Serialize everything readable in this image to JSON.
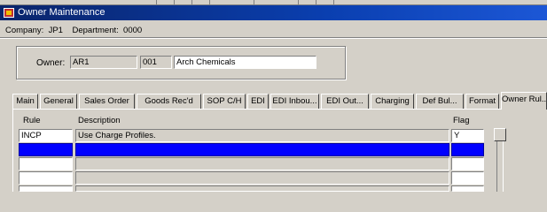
{
  "window": {
    "title": "Owner Maintenance"
  },
  "context": {
    "text": "Company:  JP1    Department:  0000"
  },
  "owner": {
    "label": "Owner:",
    "code": "AR1",
    "sub_code": "001",
    "name": "Arch Chemicals"
  },
  "tabs": [
    {
      "label": "Main"
    },
    {
      "label": "General"
    },
    {
      "label": "Sales Order"
    },
    {
      "label": "Goods Rec'd"
    },
    {
      "label": "SOP C/H"
    },
    {
      "label": "EDI"
    },
    {
      "label": "EDI Inbou..."
    },
    {
      "label": "EDI Out..."
    },
    {
      "label": "Charging"
    },
    {
      "label": "Def Bul..."
    },
    {
      "label": "Format"
    },
    {
      "label": "Owner Rul..."
    }
  ],
  "active_tab": "Owner Rul...",
  "grid": {
    "columns": {
      "rule": "Rule",
      "description": "Description",
      "flag": "Flag"
    },
    "rows": [
      {
        "rule": "INCP",
        "description": "Use Charge Profiles.",
        "flag": "Y"
      },
      {
        "rule": "",
        "description": "",
        "flag": ""
      },
      {
        "rule": "",
        "description": "",
        "flag": ""
      },
      {
        "rule": "",
        "description": "",
        "flag": ""
      },
      {
        "rule": "",
        "description": "",
        "flag": ""
      }
    ]
  },
  "colors": {
    "selection": "#0000ff",
    "titlebar": "#0a246a",
    "face": "#d4d0c8"
  }
}
